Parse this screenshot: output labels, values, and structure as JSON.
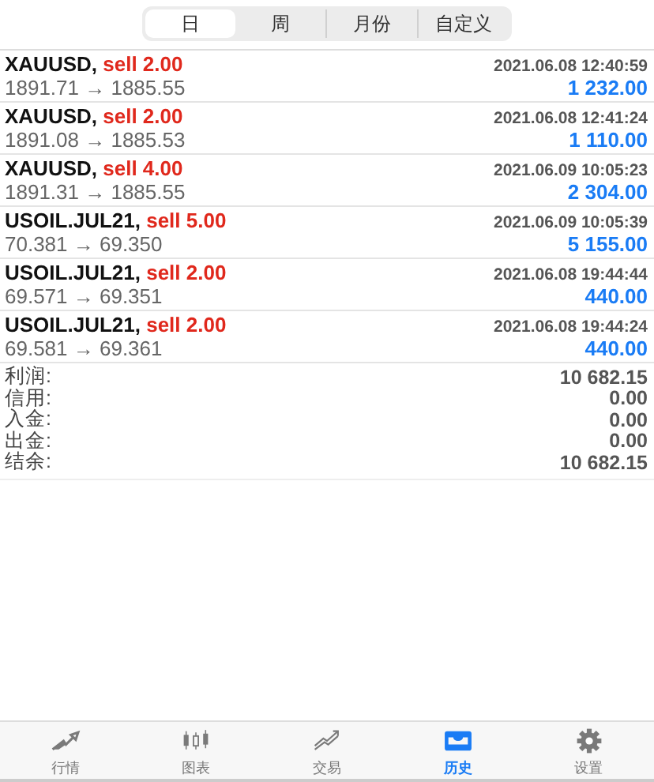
{
  "period_tabs": [
    {
      "label": "日",
      "selected": true
    },
    {
      "label": "周",
      "selected": false
    },
    {
      "label": "月份",
      "selected": false
    },
    {
      "label": "自定义",
      "selected": false
    }
  ],
  "deals": [
    {
      "symbol": "XAUUSD,",
      "side": "sell 2.00",
      "time": "2021.06.08 12:40:59",
      "prices": "1891.71 → 1885.55",
      "profit": "1 232.00"
    },
    {
      "symbol": "XAUUSD,",
      "side": "sell 2.00",
      "time": "2021.06.08 12:41:24",
      "prices": "1891.08 → 1885.53",
      "profit": "1 110.00"
    },
    {
      "symbol": "XAUUSD,",
      "side": "sell 4.00",
      "time": "2021.06.09 10:05:23",
      "prices": "1891.31 → 1885.55",
      "profit": "2 304.00"
    },
    {
      "symbol": "USOIL.JUL21,",
      "side": "sell 5.00",
      "time": "2021.06.09 10:05:39",
      "prices": "70.381 → 69.350",
      "profit": "5 155.00"
    },
    {
      "symbol": "USOIL.JUL21,",
      "side": "sell 2.00",
      "time": "2021.06.08 19:44:44",
      "prices": "69.571 → 69.351",
      "profit": "440.00"
    },
    {
      "symbol": "USOIL.JUL21,",
      "side": "sell 2.00",
      "time": "2021.06.08 19:44:24",
      "prices": "69.581 → 69.361",
      "profit": "440.00"
    }
  ],
  "summary": [
    {
      "label": "利润:",
      "value": "10 682.15"
    },
    {
      "label": "信用:",
      "value": "0.00"
    },
    {
      "label": "入金:",
      "value": "0.00"
    },
    {
      "label": "出金:",
      "value": "0.00"
    },
    {
      "label": "结余:",
      "value": "10 682.15"
    }
  ],
  "tab_bar": [
    {
      "label": "行情",
      "selected": false
    },
    {
      "label": "图表",
      "selected": false
    },
    {
      "label": "交易",
      "selected": false
    },
    {
      "label": "历史",
      "selected": true
    },
    {
      "label": "设置",
      "selected": false
    }
  ]
}
